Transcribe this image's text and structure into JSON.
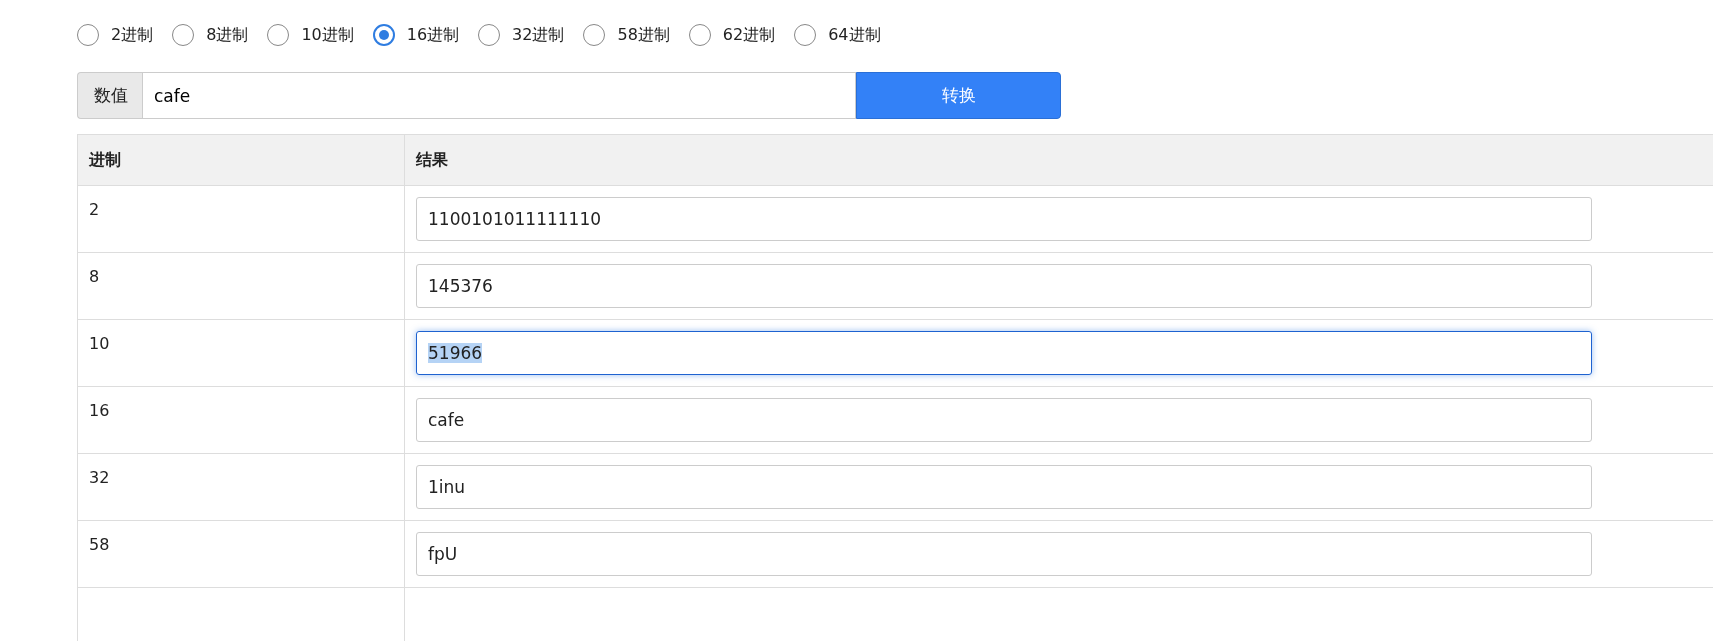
{
  "radix_options": [
    {
      "label": "2进制",
      "selected": false
    },
    {
      "label": "8进制",
      "selected": false
    },
    {
      "label": "10进制",
      "selected": false
    },
    {
      "label": "16进制",
      "selected": true
    },
    {
      "label": "32进制",
      "selected": false
    },
    {
      "label": "58进制",
      "selected": false
    },
    {
      "label": "62进制",
      "selected": false
    },
    {
      "label": "64进制",
      "selected": false
    }
  ],
  "input": {
    "addon": "数值",
    "value": "cafe"
  },
  "convert_button": "转换",
  "table": {
    "columns": [
      "进制",
      "结果"
    ],
    "rows": [
      {
        "radix": "2",
        "result": "1100101011111110",
        "focused": false
      },
      {
        "radix": "8",
        "result": "145376",
        "focused": false
      },
      {
        "radix": "10",
        "result": "51966",
        "focused": true
      },
      {
        "radix": "16",
        "result": "cafe",
        "focused": false
      },
      {
        "radix": "32",
        "result": "1inu",
        "focused": false
      },
      {
        "radix": "58",
        "result": "fpU",
        "focused": false
      }
    ]
  }
}
